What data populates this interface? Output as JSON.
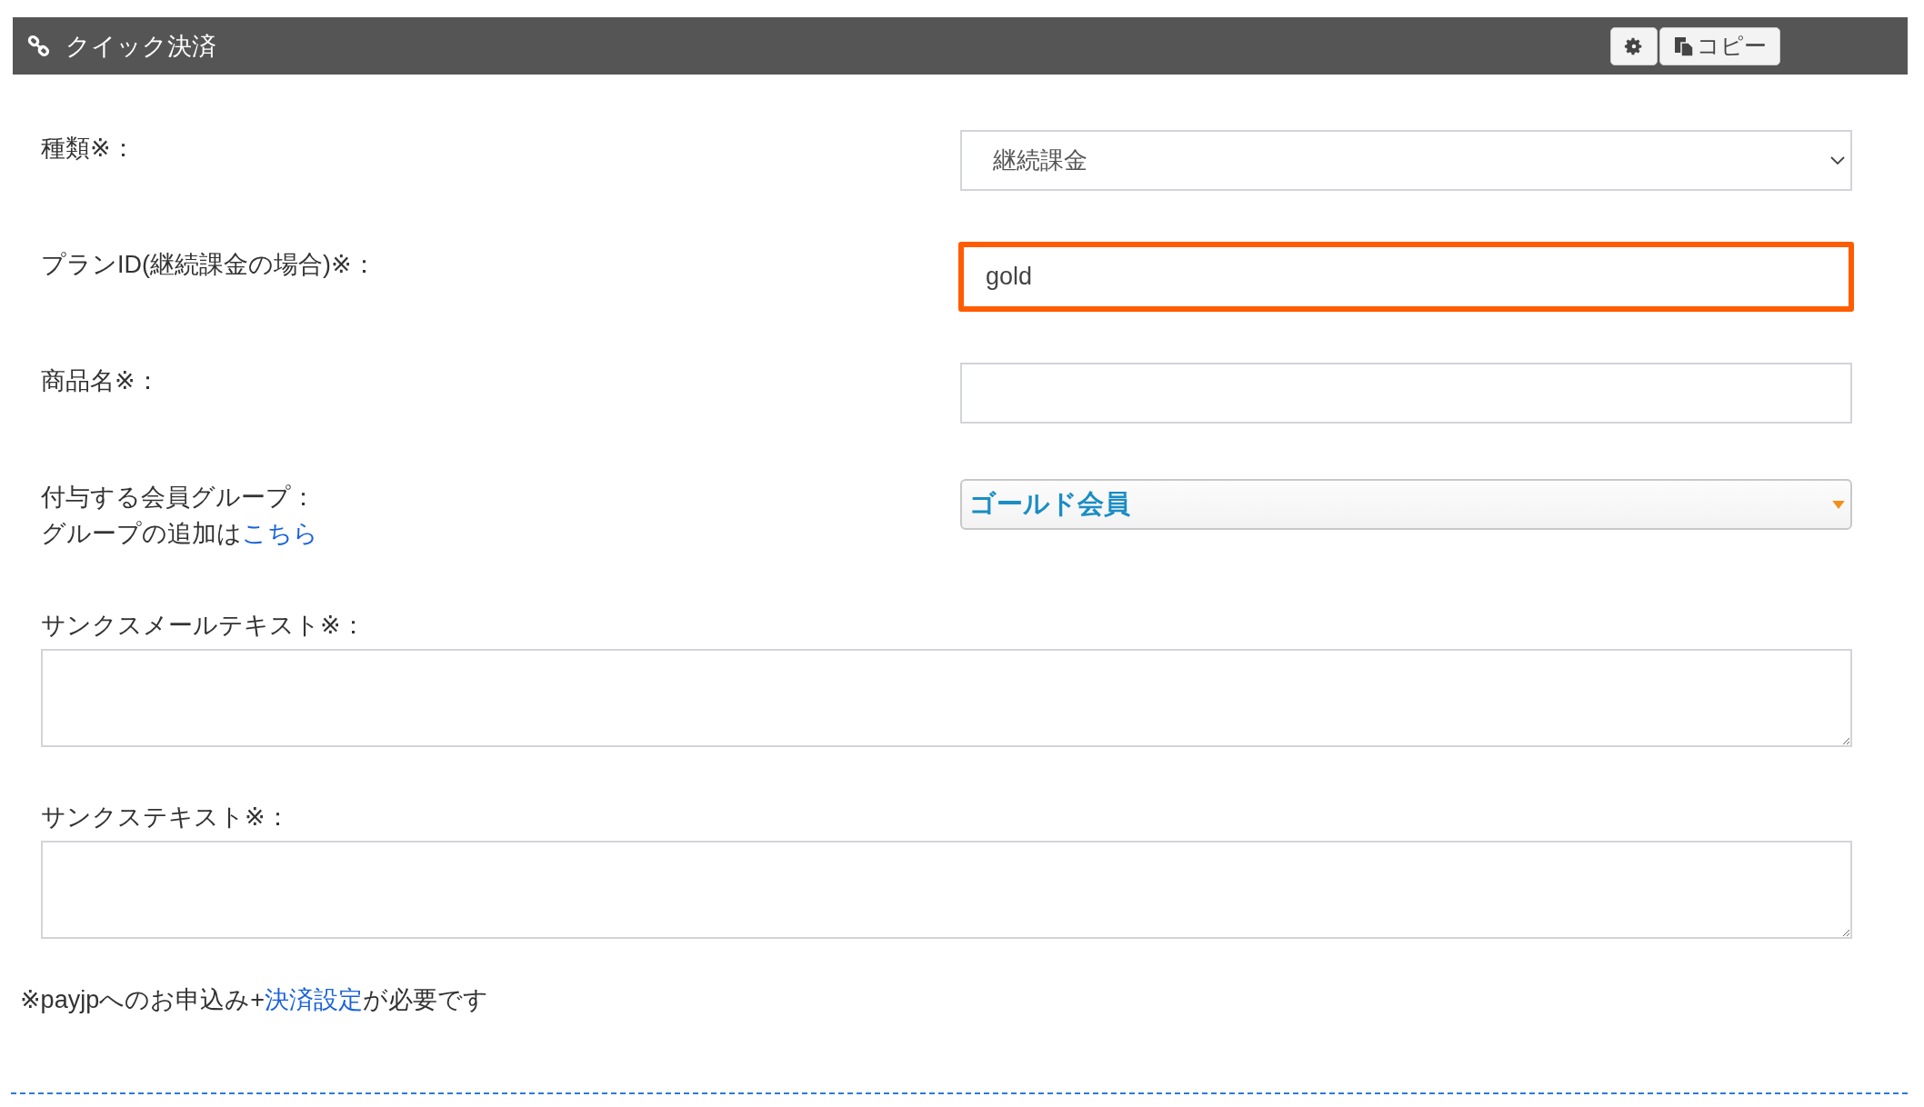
{
  "header": {
    "title": "クイック決済",
    "buttons": [
      {
        "kind": "settings"
      },
      {
        "kind": "copy",
        "label": "コピー"
      }
    ]
  },
  "fields": [
    {
      "kind": "select",
      "label": "種類※：",
      "value": "継続課金",
      "highlighted": false
    },
    {
      "kind": "text",
      "label": "プランID(継続課金の場合)※：",
      "value": "gold",
      "highlighted": true
    },
    {
      "kind": "text",
      "label": "商品名※：",
      "highlighted": false
    },
    {
      "kind": "group-select",
      "label": "付与する会員グループ：",
      "note": "グループの追加は",
      "link": "こちら",
      "value": "ゴールド会員",
      "highlighted": false
    },
    {
      "kind": "textarea",
      "label": "サンクスメールテキスト※：",
      "highlighted": false
    },
    {
      "kind": "textarea",
      "label": "サンクステキスト※：",
      "highlighted": false
    }
  ],
  "footer": {
    "before": "※payjpへのお申込み+",
    "link": "決済設定",
    "after": "が必要です"
  }
}
